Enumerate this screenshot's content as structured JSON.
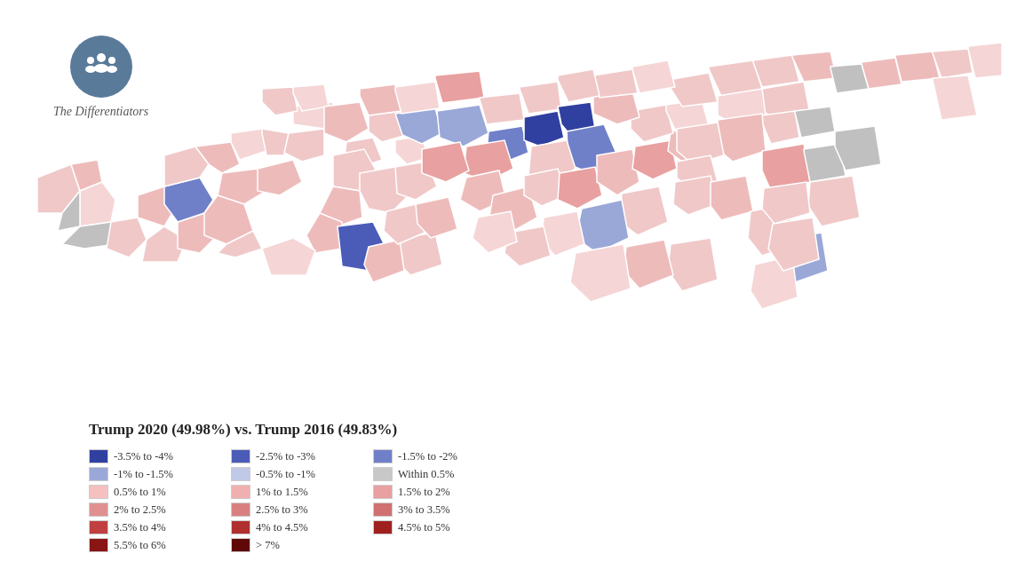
{
  "brand": {
    "name": "The Differentiators"
  },
  "legend": {
    "title": "Trump 2020 (49.98%) vs. Trump 2016 (49.83%)",
    "items": [
      {
        "color": "#3040a0",
        "label": "-3.5% to -4%",
        "col": 0
      },
      {
        "color": "#e8a0a0",
        "label": "0.5% to 1%",
        "col": 1
      },
      {
        "color": "#c04040",
        "label": "3.5% to 4%",
        "col": 2
      },
      {
        "color": "#4a5cb8",
        "label": "-2.5% to -3%",
        "col": 0
      },
      {
        "color": "#eebbbb",
        "label": "1% to 1.5%",
        "col": 1
      },
      {
        "color": "#bf3535",
        "label": "4% to 4.5%",
        "col": 2
      },
      {
        "color": "#7080c8",
        "label": "-1.5% to -2%",
        "col": 0
      },
      {
        "color": "#f0c8c8",
        "label": "1.5% to 2%",
        "col": 1
      },
      {
        "color": "#b02828",
        "label": "4.5% to 5%",
        "col": 2
      },
      {
        "color": "#9aa8d8",
        "label": "-1% to -1.5%",
        "col": 0
      },
      {
        "color": "#f5d5d5",
        "label": "2% to 2.5%",
        "col": 1
      },
      {
        "color": "#922020",
        "label": "5.5% to 6%",
        "col": 2
      },
      {
        "color": "#c0cae8",
        "label": "-0.5% to -1%",
        "col": 0
      },
      {
        "color": "#f7dede",
        "label": "2.5% to 3%",
        "col": 1
      },
      {
        "color": "#700808",
        "label": "> 7%",
        "col": 2
      },
      {
        "color": "#c0c0c0",
        "label": "Within 0.5%",
        "col": 0
      },
      {
        "color": "#fae8e8",
        "label": "3% to 3.5%",
        "col": 1
      }
    ]
  }
}
